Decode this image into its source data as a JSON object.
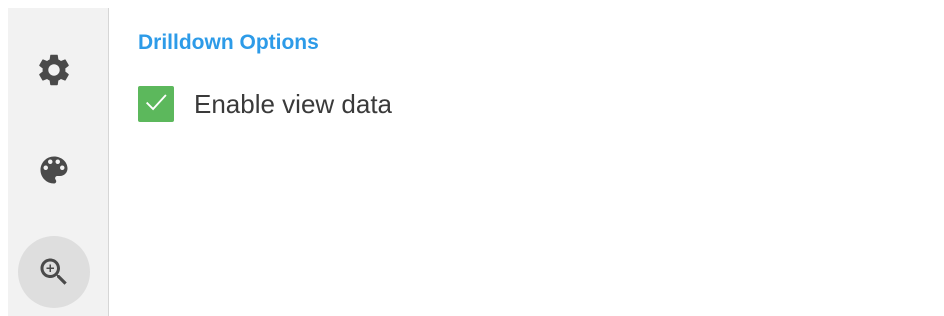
{
  "sidebar": {
    "items": [
      {
        "icon": "gear-icon",
        "active": false
      },
      {
        "icon": "palette-icon",
        "active": false
      },
      {
        "icon": "zoom-in-icon",
        "active": true
      }
    ]
  },
  "drilldown": {
    "title": "Drilldown Options",
    "options": [
      {
        "label": "Enable view data",
        "checked": true
      }
    ]
  },
  "colors": {
    "title": "#2d9be8",
    "checkbox": "#5cb85c",
    "sidebar_bg": "#f2f2f2",
    "active_bg": "#dedede",
    "icon": "#4a4a4a"
  }
}
